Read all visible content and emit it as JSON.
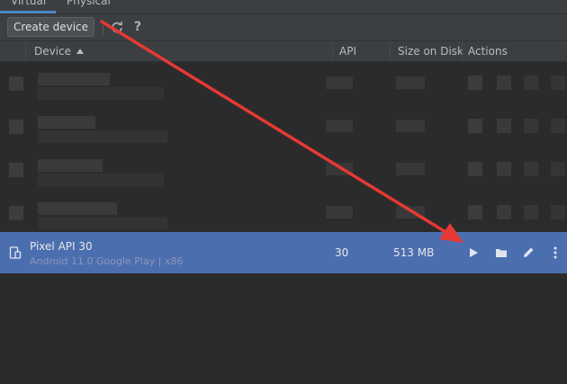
{
  "tabs": [
    {
      "label": "Virtual",
      "active": true
    },
    {
      "label": "Physical",
      "active": false
    }
  ],
  "toolbar": {
    "create_label": "Create device",
    "help_label": "?"
  },
  "table": {
    "columns": [
      "Device",
      "API",
      "Size on Disk",
      "Actions"
    ],
    "sort_column": "Device",
    "sort_direction": "ascending"
  },
  "selected_device": {
    "name": "Pixel API 30",
    "details": "Android 11.0 Google Play | x86",
    "api": "30",
    "size": "513 MB"
  },
  "colors": {
    "selection": "#4b6eaf",
    "annotation_arrow": "#e53935",
    "accent": "#4a88c7"
  },
  "icons": [
    "refresh-icon",
    "help-icon",
    "device-phone-icon",
    "play-icon",
    "folder-icon",
    "edit-pencil-icon",
    "more-vertical-icon"
  ]
}
